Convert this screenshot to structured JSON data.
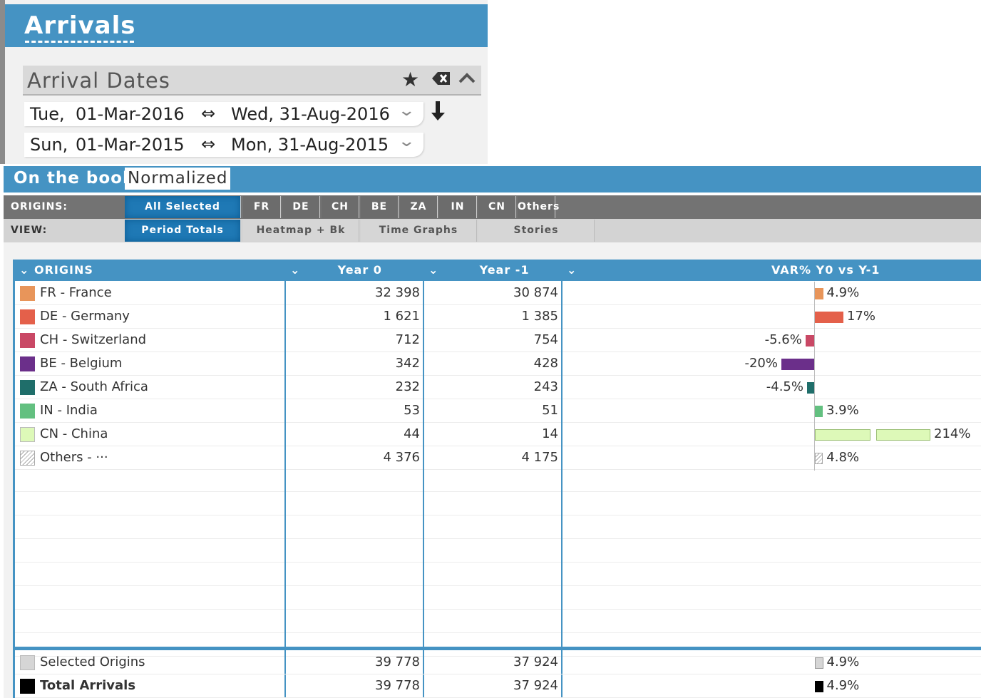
{
  "arrivals": {
    "title": "Arrivals",
    "section_title": "Arrival Dates",
    "icons": [
      "star-icon",
      "clear-icon",
      "collapse-icon"
    ],
    "ranges": [
      {
        "from_day": "Tue,",
        "from_date": "01-Mar-2016",
        "to": "Wed, 31-Aug-2016"
      },
      {
        "from_day": "Sun,",
        "from_date": "01-Mar-2015",
        "to": "Mon, 31-Aug-2015"
      }
    ]
  },
  "book": {
    "label": "On the book",
    "mode": "Normalized"
  },
  "filters": {
    "origins_label": "ORIGINS:",
    "origins": [
      "All Selected",
      "FR",
      "DE",
      "CH",
      "BE",
      "ZA",
      "IN",
      "CN",
      "Others"
    ],
    "active_origin": "All Selected",
    "view_label": "VIEW:",
    "views": [
      "Period Totals",
      "Heatmap + Bk Pace",
      "Time Graphs",
      "Stories"
    ],
    "active_view": "Period Totals"
  },
  "table": {
    "headers": {
      "origins": "ORIGINS",
      "year0": "Year 0",
      "year1": "Year -1",
      "var": "VAR% Y0 vs Y-1"
    },
    "rows": [
      {
        "name": "FR - France",
        "color": "#e8955a",
        "y0": "32 398",
        "y1": "30 874",
        "var": 4.9,
        "var_label": "4.9%"
      },
      {
        "name": "DE - Germany",
        "color": "#e4604a",
        "y0": "1 621",
        "y1": "1 385",
        "var": 17,
        "var_label": "17%"
      },
      {
        "name": "CH - Switzerland",
        "color": "#c94865",
        "y0": "712",
        "y1": "754",
        "var": -5.6,
        "var_label": "-5.6%"
      },
      {
        "name": "BE - Belgium",
        "color": "#6b2f8a",
        "y0": "342",
        "y1": "428",
        "var": -20,
        "var_label": "-20%"
      },
      {
        "name": "ZA - South Africa",
        "color": "#1f6e6a",
        "y0": "232",
        "y1": "243",
        "var": -4.5,
        "var_label": "-4.5%"
      },
      {
        "name": "IN - India",
        "color": "#63c080",
        "y0": "53",
        "y1": "51",
        "var": 3.9,
        "var_label": "3.9%"
      },
      {
        "name": "CN - China",
        "color": "#ddf9b8",
        "y0": "44",
        "y1": "14",
        "var": 214,
        "var_label": "214%"
      },
      {
        "name": "Others - ···",
        "color": "hatch",
        "y0": "4 376",
        "y1": "4 175",
        "var": 4.8,
        "var_label": "4.8%"
      }
    ],
    "footer": [
      {
        "name": "Selected Origins",
        "color": "#d6d6d6",
        "y0": "39 778",
        "y1": "37 924",
        "var": 4.9,
        "var_label": "4.9%",
        "bold": false
      },
      {
        "name": "Total Arrivals",
        "color": "#000000",
        "y0": "39 778",
        "y1": "37 924",
        "var": 4.9,
        "var_label": "4.9%",
        "bold": true
      }
    ]
  }
}
